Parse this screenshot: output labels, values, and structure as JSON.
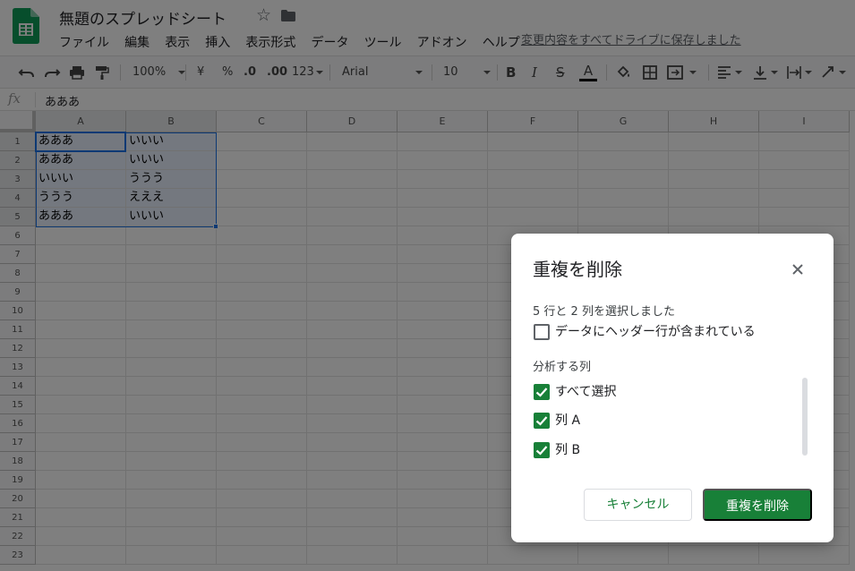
{
  "app": {
    "doc_title": "無題のスプレッドシート",
    "save_status": "変更内容をすべてドライブに保存しました"
  },
  "menu": [
    "ファイル",
    "編集",
    "表示",
    "挿入",
    "表示形式",
    "データ",
    "ツール",
    "アドオン",
    "ヘルプ"
  ],
  "toolbar": {
    "zoom": "100%",
    "currency": "¥",
    "percent": "%",
    "decrease_decimal": ".0",
    "increase_decimal": ".00",
    "number_format": "123",
    "font": "Arial",
    "font_size": "10",
    "bold": "B",
    "italic": "I",
    "strikethrough": "S",
    "text_color": "A"
  },
  "formula_bar": {
    "fx": "fx",
    "value": "あああ"
  },
  "sheet": {
    "columns": [
      "A",
      "B",
      "C",
      "D",
      "E",
      "F",
      "G",
      "H",
      "I"
    ],
    "rows": [
      "1",
      "2",
      "3",
      "4",
      "5",
      "6",
      "7",
      "8",
      "9",
      "10",
      "11",
      "12",
      "13",
      "14",
      "15",
      "16",
      "17",
      "18",
      "19",
      "20",
      "21",
      "22",
      "23"
    ],
    "cells": [
      [
        "あああ",
        "いいい"
      ],
      [
        "あああ",
        "いいい"
      ],
      [
        "いいい",
        "ううう"
      ],
      [
        "ううう",
        "えええ"
      ],
      [
        "あああ",
        "いいい"
      ]
    ]
  },
  "dialog": {
    "title": "重複を削除",
    "summary": "5 行と 2 列を選択しました",
    "header_checkbox": {
      "label": "データにヘッダー行が含まれている",
      "checked": false
    },
    "section_label": "分析する列",
    "column_checkboxes": [
      {
        "label": "すべて選択",
        "checked": true
      },
      {
        "label": "列 A",
        "checked": true
      },
      {
        "label": "列 B",
        "checked": true
      }
    ],
    "cancel_label": "キャンセル",
    "remove_label": "重複を削除"
  },
  "colors": {
    "accent_green": "#188038",
    "selection_blue": "#1a73e8"
  }
}
